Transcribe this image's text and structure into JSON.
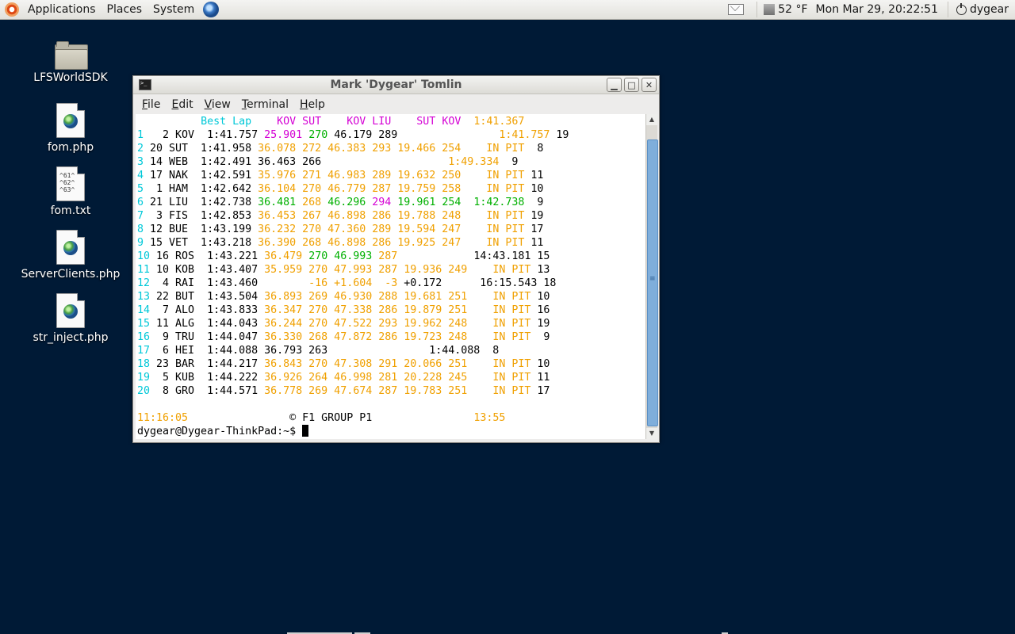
{
  "panel": {
    "menus": [
      "Applications",
      "Places",
      "System"
    ],
    "temperature": "52 °F",
    "clock": "Mon Mar 29, 20:22:51",
    "user": "dygear",
    "icons": [
      "ubuntu-logo-icon",
      "web-browser-icon",
      "mail-icon",
      "weather-icon",
      "power-icon"
    ]
  },
  "desktop": {
    "icons": [
      {
        "label": "LFSWorldSDK",
        "type": "folder"
      },
      {
        "label": "fom.php",
        "type": "php-file"
      },
      {
        "label": "fom.txt",
        "type": "text-file",
        "preview": [
          "^61^",
          "^62^",
          "^63^"
        ]
      },
      {
        "label": "ServerClients.php",
        "type": "php-file"
      },
      {
        "label": "str_inject.php",
        "type": "php-file"
      }
    ]
  },
  "window": {
    "title": "Mark 'Dygear' Tomlin",
    "menus": [
      "File",
      "Edit",
      "View",
      "Terminal",
      "Help"
    ],
    "prompt": "dygear@Dygear-ThinkPad:~$ "
  },
  "terminal": {
    "header": [
      {
        "t": "          ",
        "c": "k"
      },
      {
        "t": "Best Lap",
        "c": "c"
      },
      {
        "t": "    ",
        "c": "k"
      },
      {
        "t": "KOV SUT",
        "c": "m"
      },
      {
        "t": "    ",
        "c": "k"
      },
      {
        "t": "KOV LIU",
        "c": "m"
      },
      {
        "t": "    ",
        "c": "k"
      },
      {
        "t": "SUT KOV",
        "c": "m"
      },
      {
        "t": "  ",
        "c": "k"
      },
      {
        "t": "1:41.367",
        "c": "o"
      }
    ],
    "rows": [
      [
        {
          "t": "1  ",
          "c": "c"
        },
        {
          "t": " 2 KOV  1:41.757 ",
          "c": "k"
        },
        {
          "t": "25.901",
          "c": "m"
        },
        {
          "t": " ",
          "c": "k"
        },
        {
          "t": "270",
          "c": "g"
        },
        {
          "t": " 46.179 289",
          "c": "k"
        },
        {
          "t": "                ",
          "c": "k"
        },
        {
          "t": "1:41.757",
          "c": "o"
        },
        {
          "t": " 19",
          "c": "k"
        }
      ],
      [
        {
          "t": "2 ",
          "c": "c"
        },
        {
          "t": "20 SUT  1:41.958 ",
          "c": "k"
        },
        {
          "t": "36.078 272 46.383 293 19.466 254",
          "c": "o"
        },
        {
          "t": "    ",
          "c": "k"
        },
        {
          "t": "IN PIT",
          "c": "o"
        },
        {
          "t": "  8",
          "c": "k"
        }
      ],
      [
        {
          "t": "3 ",
          "c": "c"
        },
        {
          "t": "14 WEB  1:42.491 36.463 266",
          "c": "k"
        },
        {
          "t": "                    ",
          "c": "k"
        },
        {
          "t": "1:49.334",
          "c": "o"
        },
        {
          "t": "  9",
          "c": "k"
        }
      ],
      [
        {
          "t": "4 ",
          "c": "c"
        },
        {
          "t": "17 NAK  1:42.591 ",
          "c": "k"
        },
        {
          "t": "35.976 271 46.983 289 19.632 250",
          "c": "o"
        },
        {
          "t": "    ",
          "c": "k"
        },
        {
          "t": "IN PIT",
          "c": "o"
        },
        {
          "t": " 11",
          "c": "k"
        }
      ],
      [
        {
          "t": "5 ",
          "c": "c"
        },
        {
          "t": " 1 HAM  1:42.642 ",
          "c": "k"
        },
        {
          "t": "36.104 270 46.779 287 19.759 258",
          "c": "o"
        },
        {
          "t": "    ",
          "c": "k"
        },
        {
          "t": "IN PIT",
          "c": "o"
        },
        {
          "t": " 10",
          "c": "k"
        }
      ],
      [
        {
          "t": "6 ",
          "c": "c"
        },
        {
          "t": "21 LIU  1:42.738 ",
          "c": "k"
        },
        {
          "t": "36.481",
          "c": "g"
        },
        {
          "t": " 268 ",
          "c": "o"
        },
        {
          "t": "46.296",
          "c": "g"
        },
        {
          "t": " ",
          "c": "k"
        },
        {
          "t": "294",
          "c": "m"
        },
        {
          "t": " ",
          "c": "k"
        },
        {
          "t": "19.961 254",
          "c": "g"
        },
        {
          "t": "  ",
          "c": "k"
        },
        {
          "t": "1:42.738",
          "c": "g"
        },
        {
          "t": "  9",
          "c": "k"
        }
      ],
      [
        {
          "t": "7 ",
          "c": "c"
        },
        {
          "t": " 3 FIS  1:42.853 ",
          "c": "k"
        },
        {
          "t": "36.453 267 46.898 286 19.788 248",
          "c": "o"
        },
        {
          "t": "    ",
          "c": "k"
        },
        {
          "t": "IN PIT",
          "c": "o"
        },
        {
          "t": " 19",
          "c": "k"
        }
      ],
      [
        {
          "t": "8 ",
          "c": "c"
        },
        {
          "t": "12 BUE  1:43.199 ",
          "c": "k"
        },
        {
          "t": "36.232 270 47.360 289 19.594 247",
          "c": "o"
        },
        {
          "t": "    ",
          "c": "k"
        },
        {
          "t": "IN PIT",
          "c": "o"
        },
        {
          "t": " 17",
          "c": "k"
        }
      ],
      [
        {
          "t": "9 ",
          "c": "c"
        },
        {
          "t": "15 VET  1:43.218 ",
          "c": "k"
        },
        {
          "t": "36.390 268 46.898 286 19.925 247",
          "c": "o"
        },
        {
          "t": "    ",
          "c": "k"
        },
        {
          "t": "IN PIT",
          "c": "o"
        },
        {
          "t": " 11",
          "c": "k"
        }
      ],
      [
        {
          "t": "10",
          "c": "c"
        },
        {
          "t": " 16 ROS  1:43.221 ",
          "c": "k"
        },
        {
          "t": "36.479",
          "c": "o"
        },
        {
          "t": " ",
          "c": "k"
        },
        {
          "t": "270 46.993",
          "c": "g"
        },
        {
          "t": " ",
          "c": "k"
        },
        {
          "t": "287",
          "c": "o"
        },
        {
          "t": "            14:43.181 15",
          "c": "k"
        }
      ],
      [
        {
          "t": "11",
          "c": "c"
        },
        {
          "t": " 10 KOB  1:43.407 ",
          "c": "k"
        },
        {
          "t": "35.959 270 47.993 287 19.936 249",
          "c": "o"
        },
        {
          "t": "    ",
          "c": "k"
        },
        {
          "t": "IN PIT",
          "c": "o"
        },
        {
          "t": " 13",
          "c": "k"
        }
      ],
      [
        {
          "t": "12",
          "c": "c"
        },
        {
          "t": "  4 RAI  1:43.460        ",
          "c": "k"
        },
        {
          "t": "-16 +1.604  -3",
          "c": "o"
        },
        {
          "t": " +0.172      16:15.543 18",
          "c": "k"
        }
      ],
      [
        {
          "t": "13",
          "c": "c"
        },
        {
          "t": " 22 BUT  1:43.504 ",
          "c": "k"
        },
        {
          "t": "36.893 269 46.930 288 19.681 251",
          "c": "o"
        },
        {
          "t": "    ",
          "c": "k"
        },
        {
          "t": "IN PIT",
          "c": "o"
        },
        {
          "t": " 10",
          "c": "k"
        }
      ],
      [
        {
          "t": "14",
          "c": "c"
        },
        {
          "t": "  7 ALO  1:43.833 ",
          "c": "k"
        },
        {
          "t": "36.347 270 47.338 286 19.879 251",
          "c": "o"
        },
        {
          "t": "    ",
          "c": "k"
        },
        {
          "t": "IN PIT",
          "c": "o"
        },
        {
          "t": " 16",
          "c": "k"
        }
      ],
      [
        {
          "t": "15",
          "c": "c"
        },
        {
          "t": " 11 ALG  1:44.043 ",
          "c": "k"
        },
        {
          "t": "36.244 270 47.522 293 19.962 248",
          "c": "o"
        },
        {
          "t": "    ",
          "c": "k"
        },
        {
          "t": "IN PIT",
          "c": "o"
        },
        {
          "t": " 19",
          "c": "k"
        }
      ],
      [
        {
          "t": "16",
          "c": "c"
        },
        {
          "t": "  9 TRU  1:44.047 ",
          "c": "k"
        },
        {
          "t": "36.330 268 47.872 286 19.723 248",
          "c": "o"
        },
        {
          "t": "    ",
          "c": "k"
        },
        {
          "t": "IN PIT",
          "c": "o"
        },
        {
          "t": "  9",
          "c": "k"
        }
      ],
      [
        {
          "t": "17",
          "c": "c"
        },
        {
          "t": "  6 HEI  1:44.088 36.793 263                1:44.088  8",
          "c": "k"
        }
      ],
      [
        {
          "t": "18",
          "c": "c"
        },
        {
          "t": " 23 BAR  1:44.217 ",
          "c": "k"
        },
        {
          "t": "36.843 270 47.308 291 20.066 251",
          "c": "o"
        },
        {
          "t": "    ",
          "c": "k"
        },
        {
          "t": "IN PIT",
          "c": "o"
        },
        {
          "t": " 10",
          "c": "k"
        }
      ],
      [
        {
          "t": "19",
          "c": "c"
        },
        {
          "t": "  5 KUB  1:44.222 ",
          "c": "k"
        },
        {
          "t": "36.926 264 46.998 281 20.228 245",
          "c": "o"
        },
        {
          "t": "    ",
          "c": "k"
        },
        {
          "t": "IN PIT",
          "c": "o"
        },
        {
          "t": " 11",
          "c": "k"
        }
      ],
      [
        {
          "t": "20",
          "c": "c"
        },
        {
          "t": "  8 GRO  1:44.571 ",
          "c": "k"
        },
        {
          "t": "36.778 269 47.674 287 19.783 251",
          "c": "o"
        },
        {
          "t": "    ",
          "c": "k"
        },
        {
          "t": "IN PIT",
          "c": "o"
        },
        {
          "t": " 17",
          "c": "k"
        }
      ]
    ],
    "footer": [
      {
        "t": "11:16:05",
        "c": "o"
      },
      {
        "t": "                ",
        "c": "k"
      },
      {
        "t": "© F1 GROUP P1",
        "c": "k"
      },
      {
        "t": "                ",
        "c": "k"
      },
      {
        "t": "13:55",
        "c": "o"
      }
    ]
  },
  "colors": {
    "desktop_bg": "#001a36",
    "cyan": "#00c8d8",
    "magenta": "#d400d4",
    "green": "#00b000",
    "orange": "#f0a000"
  }
}
